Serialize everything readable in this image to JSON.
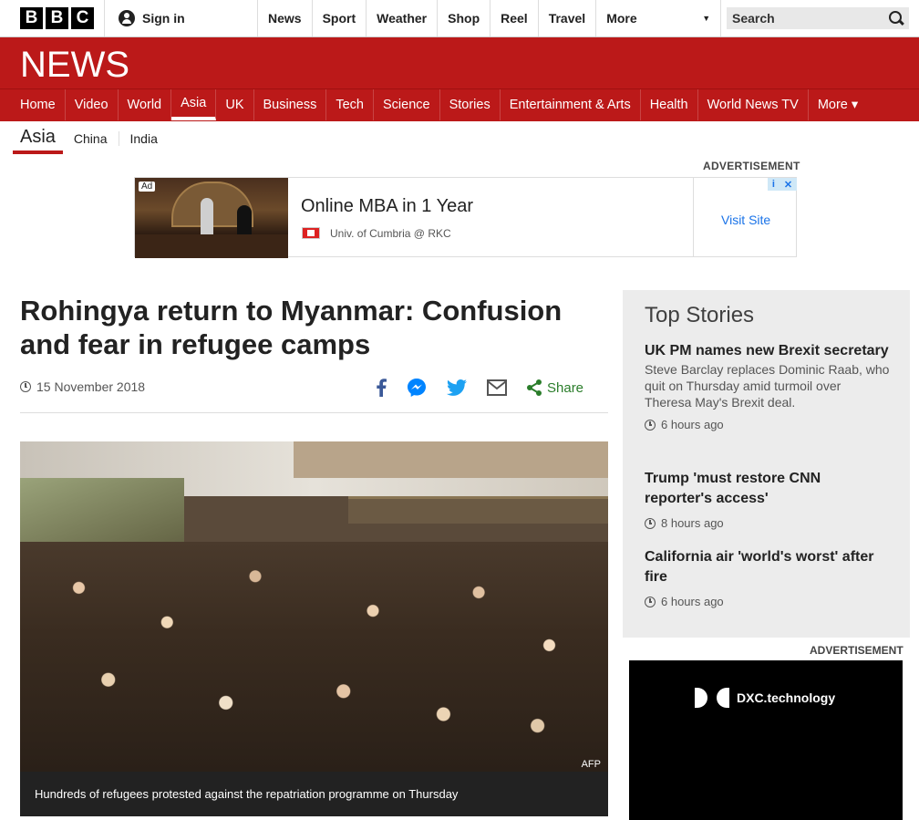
{
  "masthead": {
    "logo_letters": [
      "B",
      "B",
      "C"
    ],
    "sign_in": "Sign in",
    "nav": [
      "News",
      "Sport",
      "Weather",
      "Shop",
      "Reel",
      "Travel"
    ],
    "more": "More",
    "search_label": "Search"
  },
  "news_banner": {
    "title": "NEWS"
  },
  "news_nav": [
    "Home",
    "Video",
    "World",
    "Asia",
    "UK",
    "Business",
    "Tech",
    "Science",
    "Stories",
    "Entertainment & Arts",
    "Health",
    "World News TV",
    "More ▾"
  ],
  "news_nav_active": "Asia",
  "sub_nav": {
    "current": "Asia",
    "items": [
      "China",
      "India"
    ]
  },
  "ad_top": {
    "label": "ADVERTISEMENT",
    "badge": "Ad",
    "headline": "Online MBA in 1 Year",
    "sponsor": "Univ. of Cumbria @ RKC",
    "visit": "Visit Site",
    "choices_i": "i",
    "choices_x": "✕"
  },
  "article": {
    "headline": "Rohingya return to Myanmar: Confusion and fear in refugee camps",
    "date": "15 November 2018",
    "share_label": "Share",
    "photo_credit": "AFP",
    "caption": "Hundreds of refugees protested against the repatriation programme on Thursday"
  },
  "top_stories": {
    "heading": "Top Stories",
    "stories": [
      {
        "title": "UK PM names new Brexit secretary",
        "summary": "Steve Barclay replaces Dominic Raab, who quit on Thursday amid turmoil over Theresa May's Brexit deal.",
        "time": "6 hours ago"
      },
      {
        "title": "Trump 'must restore CNN reporter's access'",
        "summary": "",
        "time": "8 hours ago"
      },
      {
        "title": "California air 'world's worst' after fire",
        "summary": "",
        "time": "6 hours ago"
      }
    ]
  },
  "ad_side": {
    "label": "ADVERTISEMENT",
    "brand": "DXC.technology"
  },
  "colors": {
    "bbc_red": "#bb1919",
    "share_green": "#2a7d2a",
    "facebook": "#3b5998",
    "messenger": "#0084ff",
    "twitter": "#1da1f2"
  }
}
